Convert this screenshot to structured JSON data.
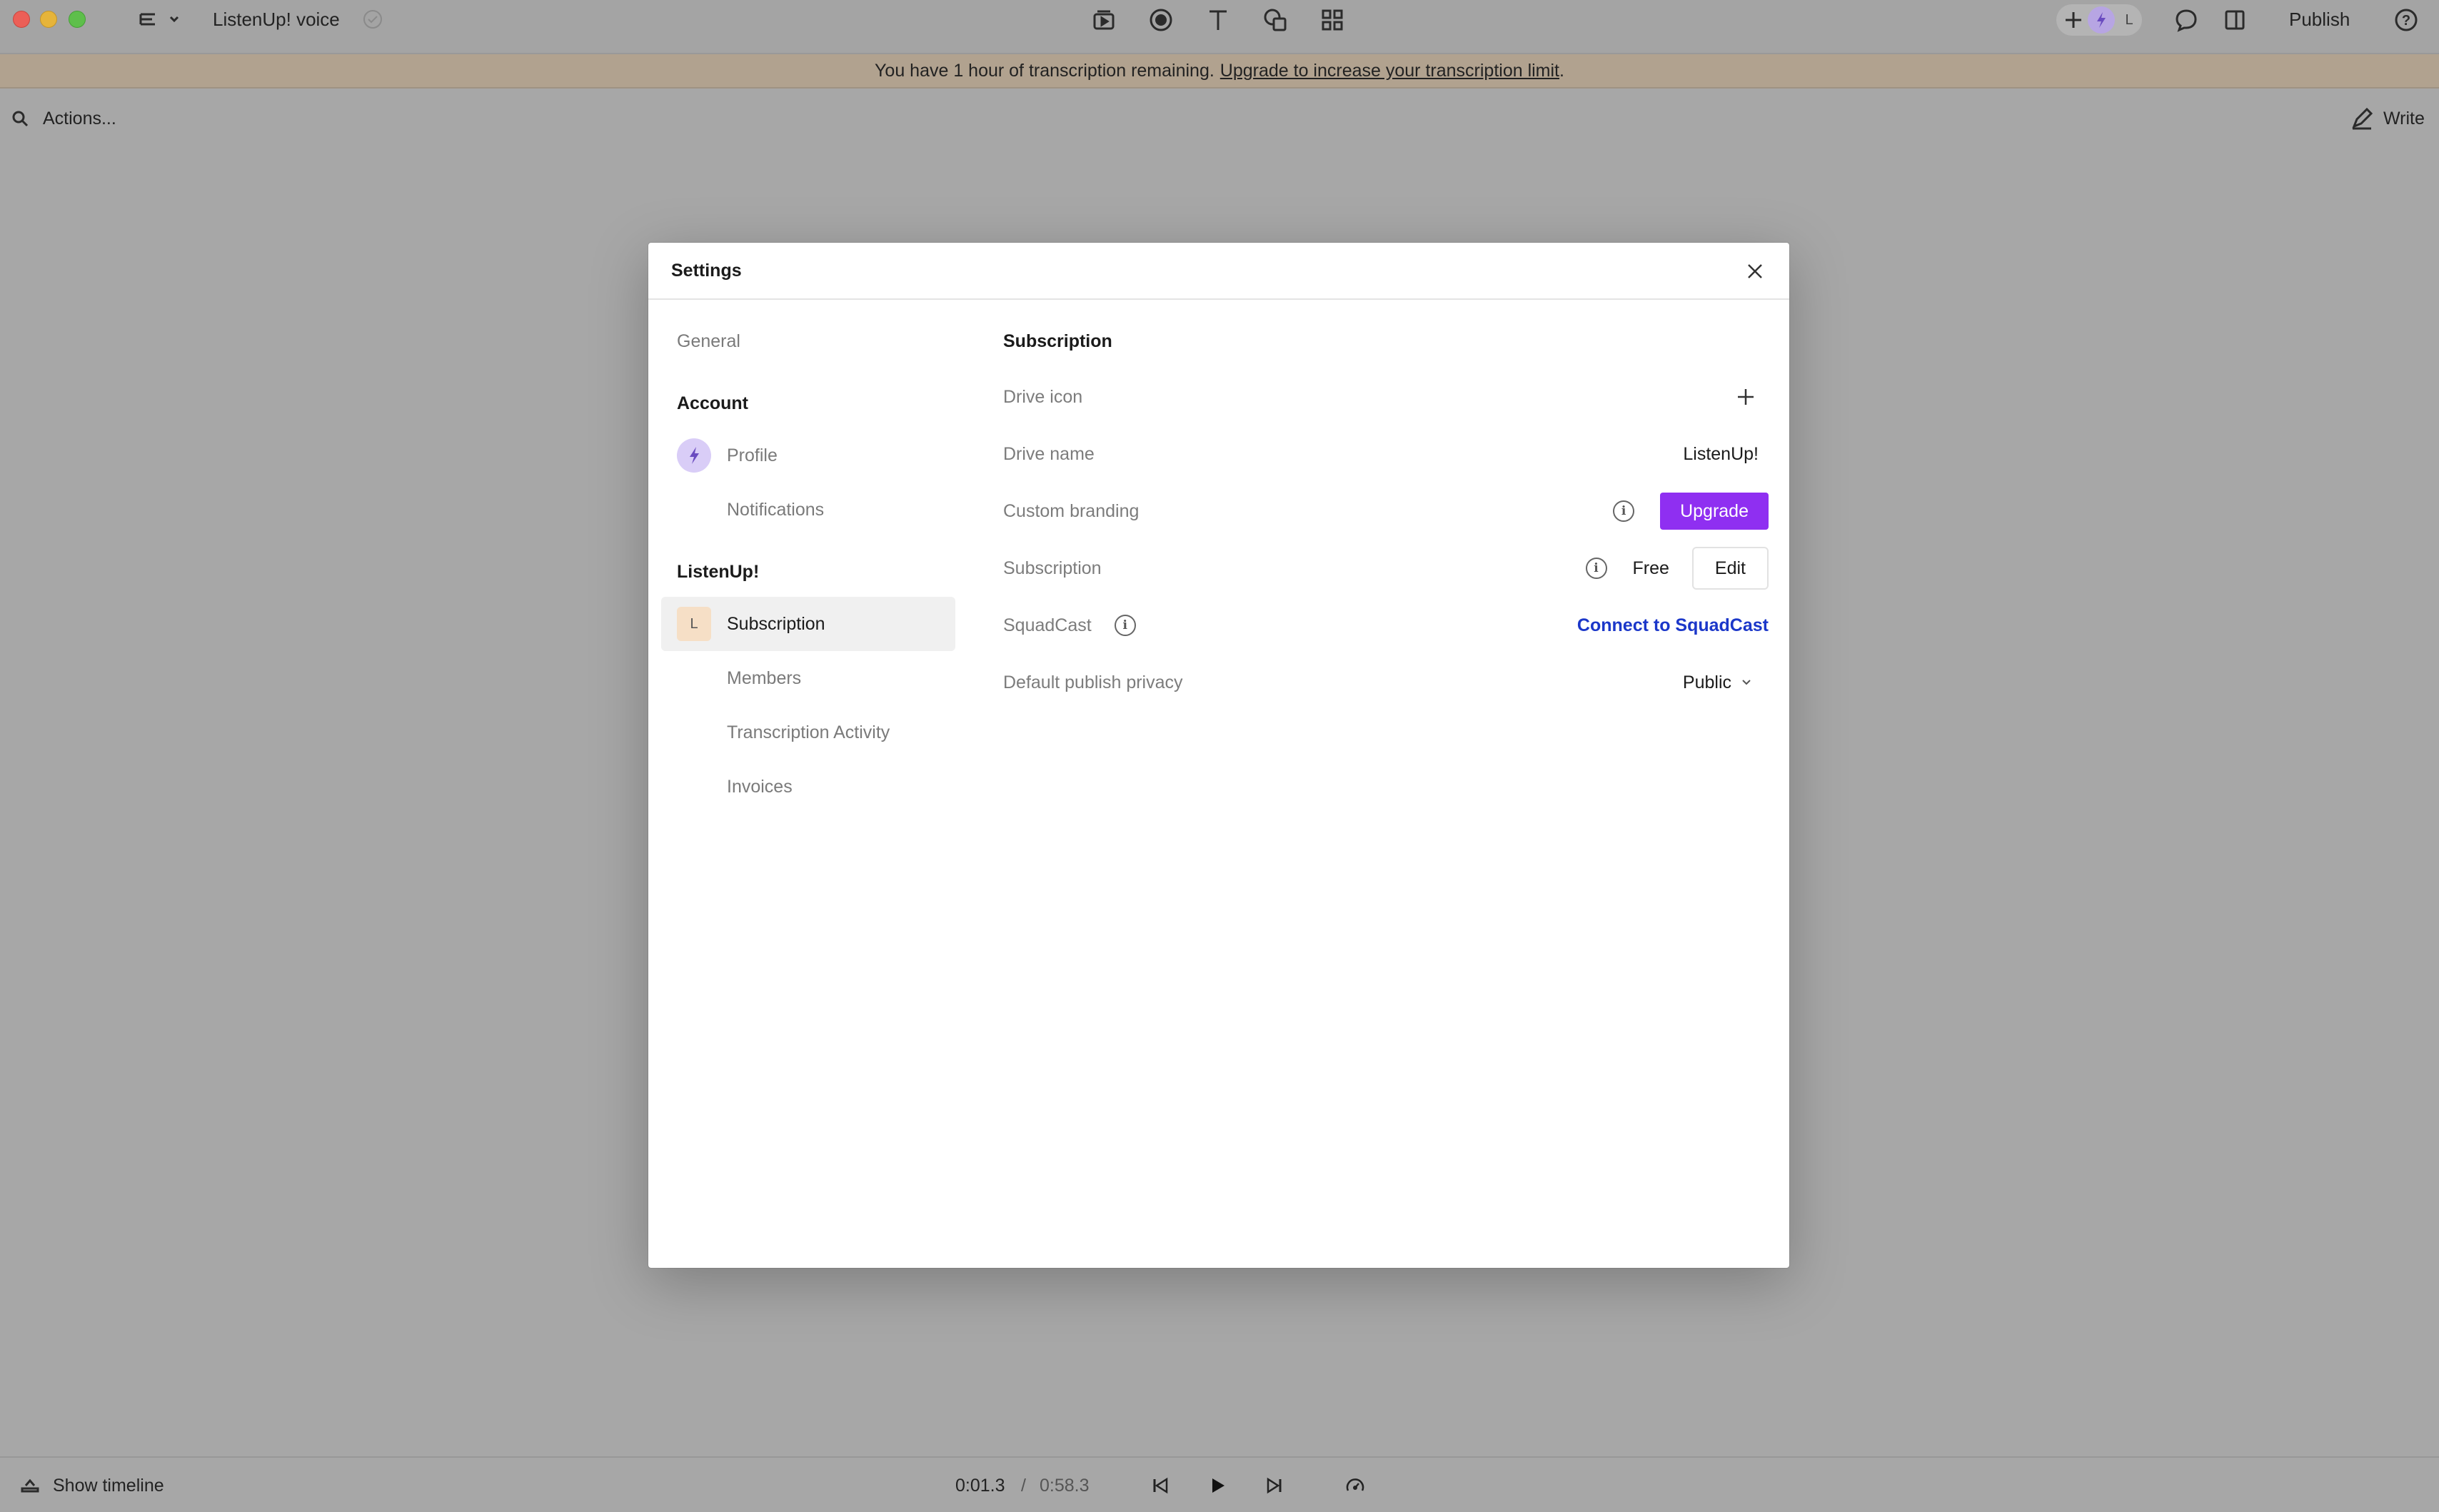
{
  "titlebar": {
    "doc_title": "ListenUp! voice",
    "publish_label": "Publish",
    "avatar_letter": "L"
  },
  "banner": {
    "text": "You have 1 hour of transcription remaining.",
    "link": "Upgrade to increase your transcription limit",
    "suffix": "."
  },
  "actionbar": {
    "search_label": "Actions...",
    "write_label": "Write"
  },
  "settings": {
    "title": "Settings",
    "sidebar": {
      "general": "General",
      "account_heading": "Account",
      "profile": "Profile",
      "notifications": "Notifications",
      "workspace_heading": "ListenUp!",
      "workspace_initial": "L",
      "subscription": "Subscription",
      "members": "Members",
      "transcription_activity": "Transcription Activity",
      "invoices": "Invoices"
    },
    "content": {
      "title": "Subscription",
      "rows": {
        "drive_icon": "Drive icon",
        "drive_name": "Drive name",
        "drive_name_value": "ListenUp!",
        "custom_branding": "Custom branding",
        "upgrade_button": "Upgrade",
        "subscription": "Subscription",
        "plan": "Free",
        "edit_button": "Edit",
        "squadcast": "SquadCast",
        "connect_squadcast": "Connect to SquadCast",
        "default_privacy": "Default publish privacy",
        "privacy_value": "Public"
      }
    }
  },
  "bottombar": {
    "show_timeline": "Show timeline",
    "current_time": "0:01.3",
    "separator": "/",
    "total_time": "0:58.3"
  },
  "colors": {
    "accent": "#8f2ff1",
    "link": "#1b37c9",
    "banner": "#b1a28f"
  }
}
